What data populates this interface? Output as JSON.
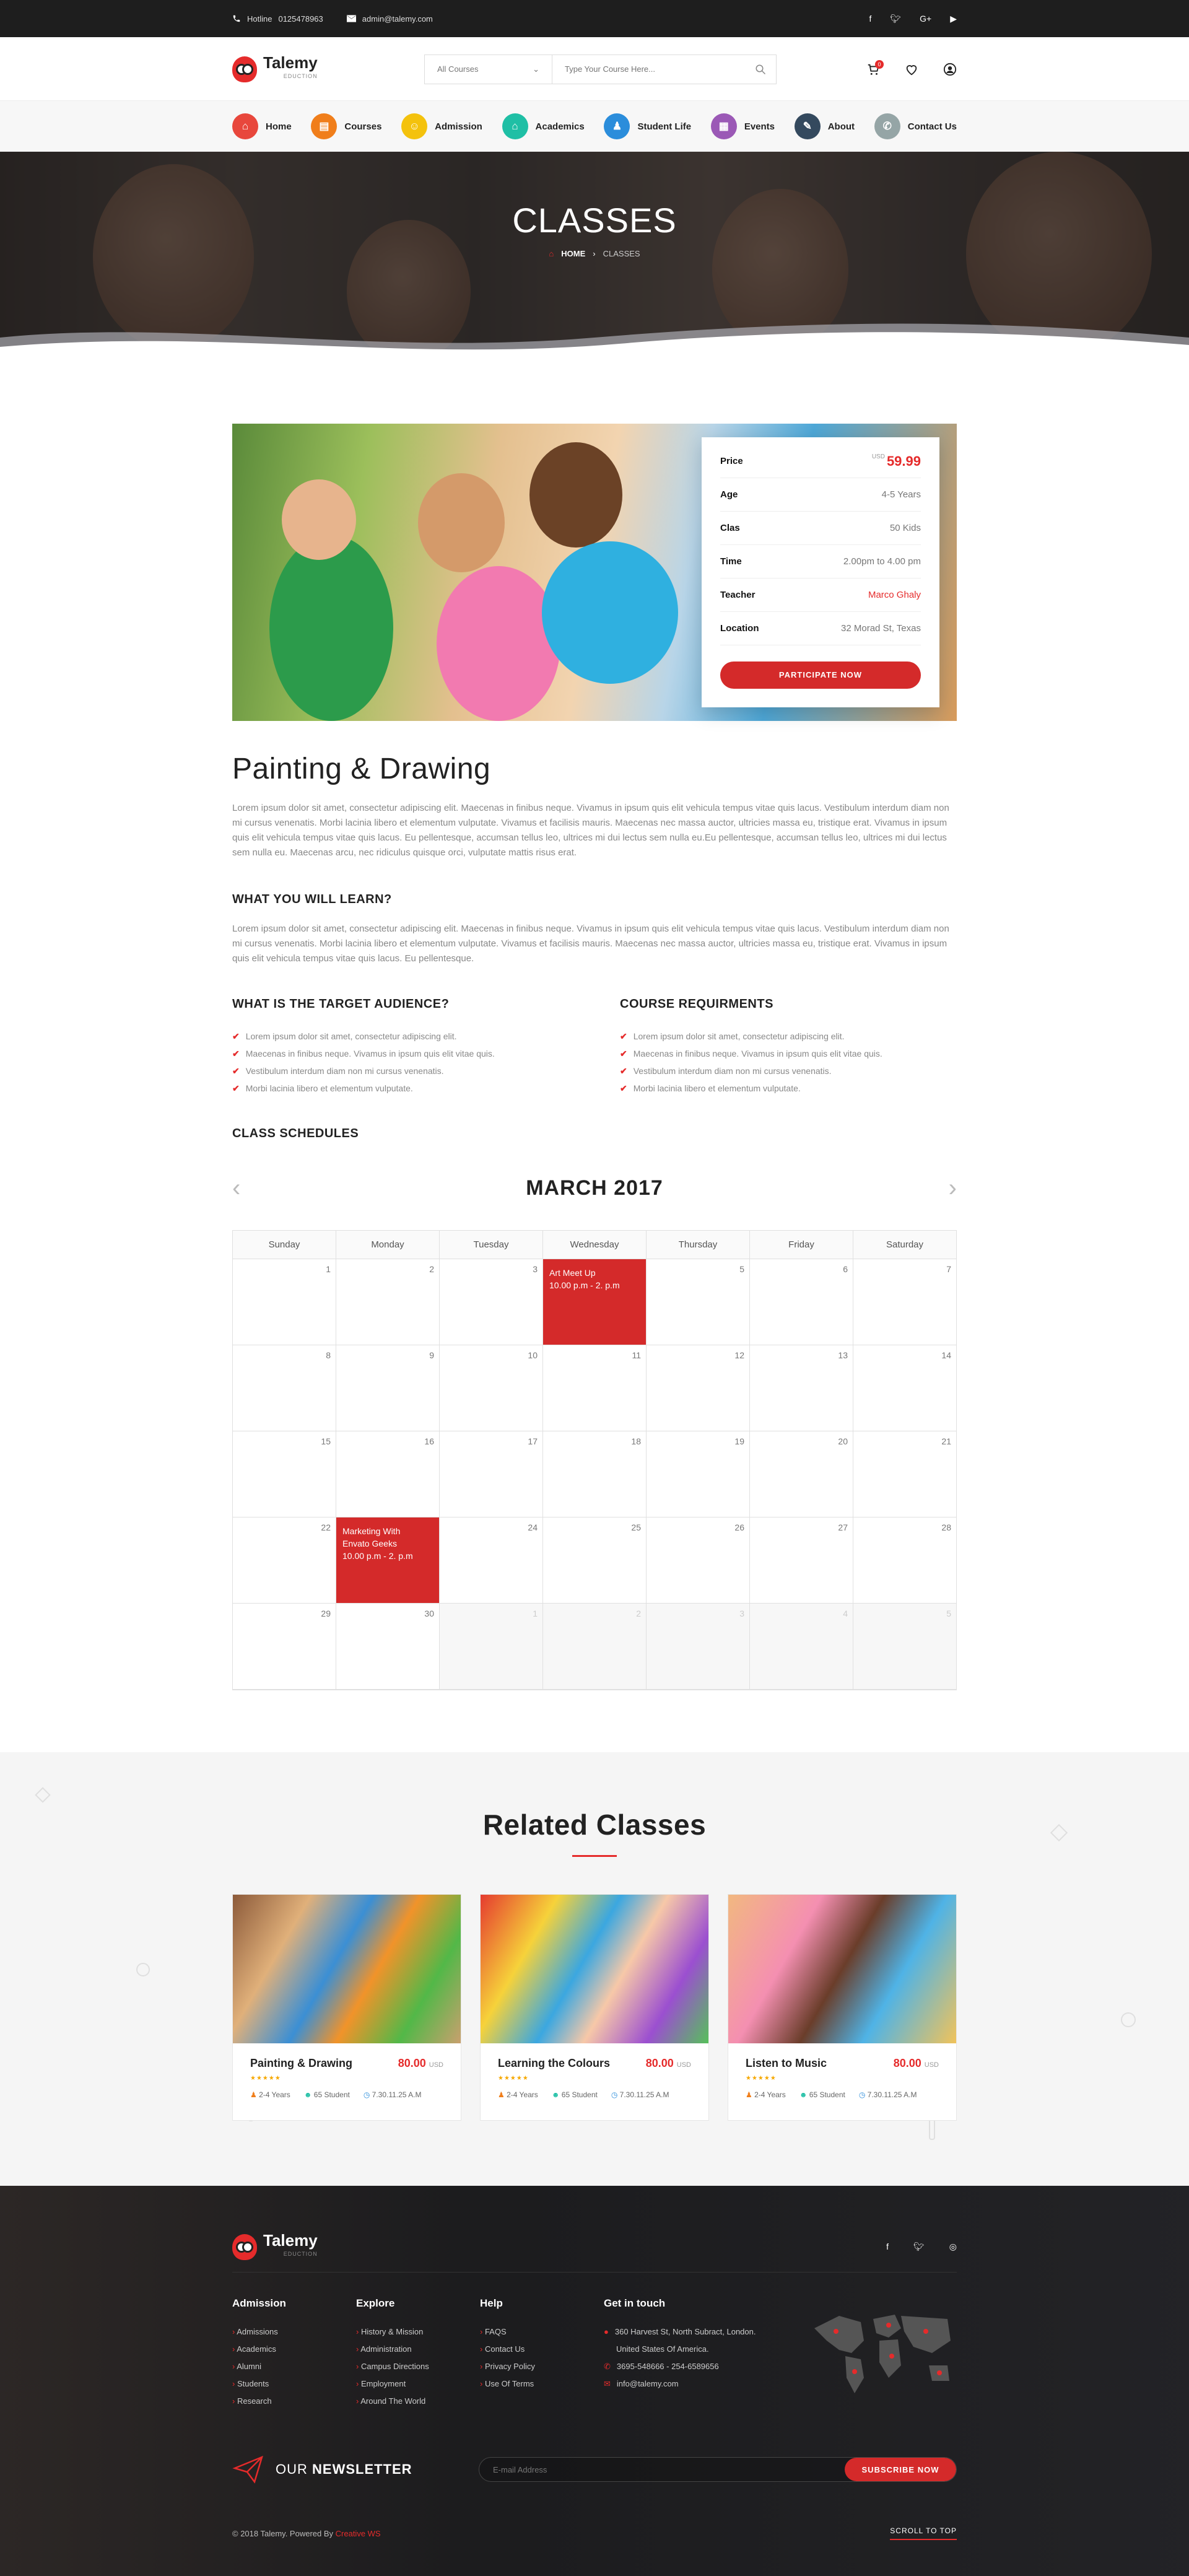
{
  "topbar": {
    "hotline_label": "Hotline",
    "hotline_number": "0125478963",
    "email": "admin@talemy.com"
  },
  "brand": {
    "name": "Talemy",
    "tagline": "EDUCTION"
  },
  "search": {
    "category": "All Courses",
    "placeholder": "Type Your Course Here..."
  },
  "header": {
    "cart_count": "0"
  },
  "nav": {
    "items": [
      {
        "label": "Home",
        "color": "#e8473c",
        "icon": "home-icon"
      },
      {
        "label": "Courses",
        "color": "#f07e1b",
        "icon": "book-icon"
      },
      {
        "label": "Admission",
        "color": "#f4c20d",
        "icon": "people-icon"
      },
      {
        "label": "Academics",
        "color": "#1fbfa5",
        "icon": "building-icon"
      },
      {
        "label": "Student Life",
        "color": "#2b8ddb",
        "icon": "person-icon"
      },
      {
        "label": "Events",
        "color": "#9b59b6",
        "icon": "calendar-icon"
      },
      {
        "label": "About",
        "color": "#34495e",
        "icon": "leaf-icon"
      },
      {
        "label": "Contact Us",
        "color": "#95a5a6",
        "icon": "phone-icon"
      }
    ]
  },
  "hero": {
    "title": "CLASSES",
    "breadcrumb_home": "HOME",
    "breadcrumb_current": "CLASSES"
  },
  "class_info": {
    "rows": [
      {
        "label": "Price",
        "currency": "USD",
        "value": "59.99"
      },
      {
        "label": "Age",
        "value": "4-5 Years"
      },
      {
        "label": "Clas",
        "value": "50 Kids"
      },
      {
        "label": "Time",
        "value": "2.00pm to 4.00 pm"
      },
      {
        "label": "Teacher",
        "value": "Marco Ghaly"
      },
      {
        "label": "Location",
        "value": "32 Morad St, Texas"
      }
    ],
    "button": "PARTICIPATE NOW"
  },
  "content": {
    "title": "Painting & Drawing",
    "intro": "Lorem ipsum dolor sit amet, consectetur adipiscing elit. Maecenas in finibus neque. Vivamus in ipsum quis elit vehicula tempus vitae quis lacus. Vestibulum interdum diam non mi cursus venenatis. Morbi lacinia libero et elementum vulputate. Vivamus et facilisis mauris. Maecenas nec massa auctor, ultricies massa eu, tristique erat. Vivamus in ipsum quis elit vehicula tempus vitae quis lacus. Eu pellentesque, accumsan tellus leo, ultrices mi dui lectus sem nulla eu.Eu pellentesque, accumsan tellus leo, ultrices mi dui lectus sem nulla eu. Maecenas arcu, nec ridiculus quisque orci, vulputate mattis risus erat.",
    "learn_title": "WHAT YOU WILL LEARN?",
    "learn_text": "Lorem ipsum dolor sit amet, consectetur adipiscing elit. Maecenas in finibus neque. Vivamus in ipsum quis elit vehicula tempus vitae quis lacus. Vestibulum interdum diam non mi cursus venenatis. Morbi lacinia libero et elementum vulputate. Vivamus et facilisis mauris. Maecenas nec massa auctor, ultricies massa eu, tristique erat. Vivamus in ipsum quis elit vehicula tempus vitae quis lacus. Eu pellentesque.",
    "audience_title": "WHAT IS THE TARGET AUDIENCE?",
    "audience_items": [
      "Lorem ipsum dolor sit amet, consectetur adipiscing elit.",
      "Maecenas in finibus neque. Vivamus in ipsum quis elit vitae quis.",
      "Vestibulum interdum diam non mi cursus venenatis.",
      "Morbi lacinia libero et elementum vulputate."
    ],
    "req_title": "COURSE REQUIRMENTS",
    "req_items": [
      "Lorem ipsum dolor sit amet, consectetur adipiscing elit.",
      "Maecenas in finibus neque. Vivamus in ipsum quis elit vitae quis.",
      "Vestibulum interdum diam non mi cursus venenatis.",
      "Morbi lacinia libero et elementum vulputate."
    ],
    "schedule_title": "CLASS SCHEDULES"
  },
  "calendar": {
    "month": "MARCH 2017",
    "days": [
      "Sunday",
      "Monday",
      "Tuesday",
      "Wednesday",
      "Thursday",
      "Friday",
      "Saturday"
    ],
    "weeks": [
      [
        {
          "n": "1"
        },
        {
          "n": "2"
        },
        {
          "n": "3"
        },
        {
          "n": "",
          "event": [
            "Art Meet Up",
            "10.00 p.m - 2. p.m"
          ]
        },
        {
          "n": "5"
        },
        {
          "n": "6"
        },
        {
          "n": "7"
        }
      ],
      [
        {
          "n": "8"
        },
        {
          "n": "9"
        },
        {
          "n": "10"
        },
        {
          "n": "11"
        },
        {
          "n": "12"
        },
        {
          "n": "13"
        },
        {
          "n": "14"
        }
      ],
      [
        {
          "n": "15"
        },
        {
          "n": "16"
        },
        {
          "n": "17"
        },
        {
          "n": "18"
        },
        {
          "n": "19"
        },
        {
          "n": "20"
        },
        {
          "n": "21"
        }
      ],
      [
        {
          "n": "22"
        },
        {
          "n": "",
          "event": [
            "Marketing With",
            "Envato Geeks",
            "10.00 p.m - 2. p.m"
          ]
        },
        {
          "n": "24"
        },
        {
          "n": "25"
        },
        {
          "n": "26"
        },
        {
          "n": "27"
        },
        {
          "n": "28"
        }
      ],
      [
        {
          "n": "29"
        },
        {
          "n": "30"
        },
        {
          "n": "1",
          "muted": true
        },
        {
          "n": "2",
          "muted": true
        },
        {
          "n": "3",
          "muted": true
        },
        {
          "n": "4",
          "muted": true
        },
        {
          "n": "5",
          "muted": true
        }
      ]
    ]
  },
  "related": {
    "title": "Related Classes",
    "cards": [
      {
        "name": "Painting & Drawing",
        "price": "80.00",
        "currency": "USD",
        "age": "2-4 Years",
        "students": "65 Student",
        "time": "7.30.11.25 A.M"
      },
      {
        "name": "Learning the Colours",
        "price": "80.00",
        "currency": "USD",
        "age": "2-4 Years",
        "students": "65 Student",
        "time": "7.30.11.25 A.M"
      },
      {
        "name": "Listen to Music",
        "price": "80.00",
        "currency": "USD",
        "age": "2-4 Years",
        "students": "65 Student",
        "time": "7.30.11.25 A.M"
      }
    ]
  },
  "footer": {
    "admission_title": "Admission",
    "admission_links": [
      "Admissions",
      "Academics",
      "Alumni",
      "Students",
      "Research"
    ],
    "explore_title": "Explore",
    "explore_links": [
      "History & Mission",
      "Administration",
      "Campus Directions",
      "Employment",
      "Around The World"
    ],
    "help_title": "Help",
    "help_links": [
      "FAQS",
      "Contact Us",
      "Privacy Policy",
      "Use Of Terms"
    ],
    "contact_title": "Get in touch",
    "address_1": "360 Harvest St, North Subract, London.",
    "address_2": "United States Of America.",
    "phone": "3695-548666  -  254-6589656",
    "email": "info@talemy.com",
    "newsletter_prefix": "OUR",
    "newsletter_title": "NEWSLETTER",
    "newsletter_placeholder": "E-mail Address",
    "newsletter_button": "SUBSCRIBE NOW",
    "copyright": "© 2018 Talemy.  Powered By",
    "powered_by": "Creative WS",
    "scroll_top": "SCROLL TO TOP"
  }
}
